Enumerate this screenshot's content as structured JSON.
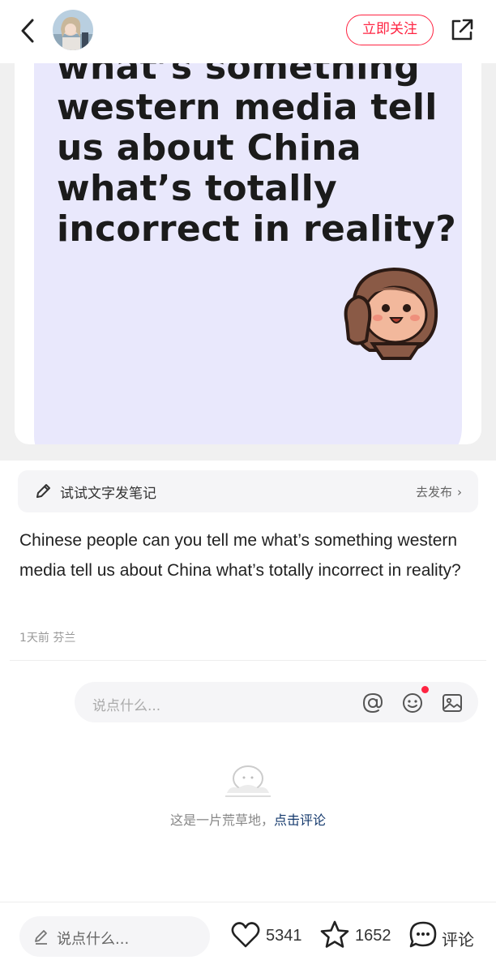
{
  "header": {
    "follow_label": "立即关注"
  },
  "post_image": {
    "headline_lines": [
      "what’s something",
      "western media tell",
      "us about China",
      "what’s totally",
      "incorrect in reality?"
    ],
    "bubble_color": "#e9e8fc"
  },
  "note_bar": {
    "label": "试试文字发笔记",
    "publish": "去发布"
  },
  "post": {
    "text": "Chinese people can you tell me what’s something western media tell us about China what’s totally incorrect in reality?",
    "meta": "1天前 芬兰"
  },
  "comment_box": {
    "placeholder": "说点什么..."
  },
  "empty_state": {
    "text": "这是一片荒草地，",
    "link": "点击评论"
  },
  "bottom_bar": {
    "input_placeholder": "说点什么...",
    "likes": "5341",
    "collects": "1652",
    "comment_label": "评论"
  },
  "colors": {
    "accent": "#ff2442",
    "link": "#13386c"
  }
}
